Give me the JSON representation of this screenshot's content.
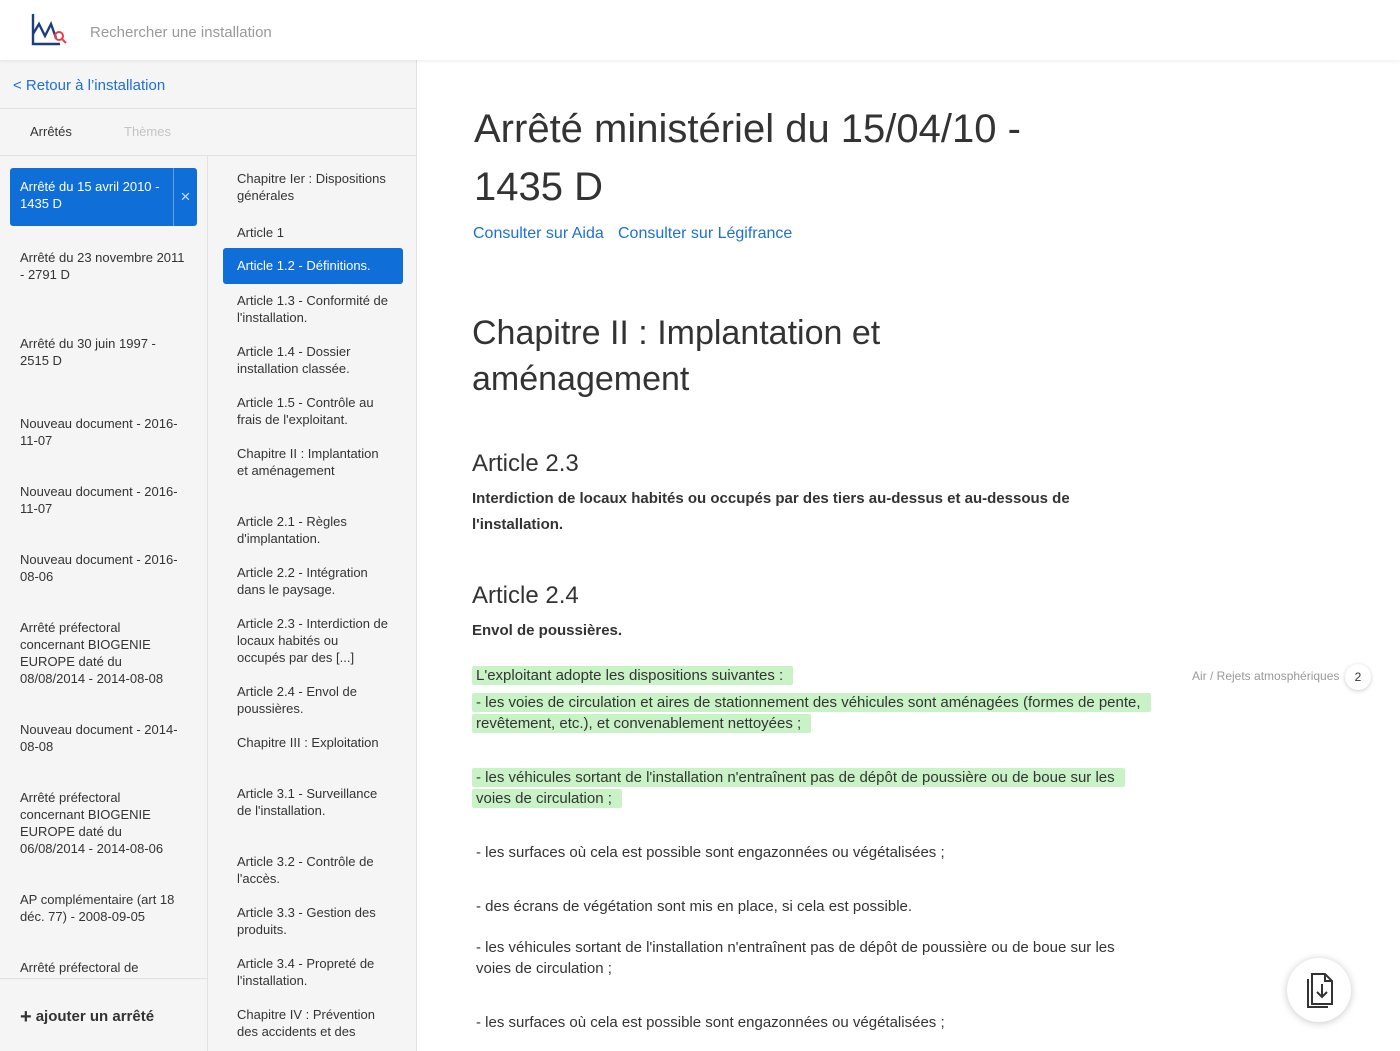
{
  "header": {
    "search_placeholder": "Rechercher une installation",
    "logo_icon": "chart-search-logo"
  },
  "sidebar": {
    "back_link": "< Retour à l’installation",
    "tabs": [
      {
        "label": "Arrêtés",
        "active": true
      },
      {
        "label": "Thèmes",
        "active": false
      }
    ],
    "arretes": [
      {
        "label": "Arrêté du 15 avril 2010 - 1435 D",
        "active": true
      },
      {
        "label": "Arrêté du 23 novembre 2011 - 2791 D"
      },
      {
        "label": "Arrêté du 30 juin 1997 - 2515 D"
      },
      {
        "label": "Nouveau document - 2016-11-07"
      },
      {
        "label": "Nouveau document - 2016-11-07"
      },
      {
        "label": "Nouveau document - 2016-08-06"
      },
      {
        "label": "Arrêté préfectoral concernant BIOGENIE EUROPE daté du 08/08/2014 - 2014-08-08"
      },
      {
        "label": "Nouveau document - 2014-08-08"
      },
      {
        "label": "Arrêté préfectoral concernant BIOGENIE EUROPE daté du 06/08/2014 - 2014-08-06"
      },
      {
        "label": "AP complémentaire (art 18 déc. 77) - 2008-09-05"
      },
      {
        "label": "Arrêté préfectoral de"
      }
    ],
    "close_icon": "×",
    "add_arrete": {
      "plus": "+",
      "label": "ajouter un arrêté"
    },
    "toc": [
      {
        "label": "Chapitre Ier : Dispositions générales"
      },
      {
        "label": "Article 1"
      },
      {
        "label": "Article 1.2 - Définitions.",
        "active": true
      },
      {
        "label": "Article 1.3 - Conformité de l'installation."
      },
      {
        "label": "Article 1.4 - Dossier installation classée."
      },
      {
        "label": "Article 1.5 - Contrôle au frais de l'exploitant."
      },
      {
        "label": "Chapitre II : Implantation et aménagement"
      },
      {
        "label": "Article 2.1 - Règles d'implantation."
      },
      {
        "label": "Article 2.2 - Intégration dans le paysage."
      },
      {
        "label": "Article 2.3 - Interdiction de locaux habités ou occupés par des [...]"
      },
      {
        "label": "Article 2.4 - Envol de poussières."
      },
      {
        "label": "Chapitre III : Exploitation"
      },
      {
        "label": "Article 3.1 - Surveillance de l'installation."
      },
      {
        "label": "Article 3.2 - Contrôle de l'accès."
      },
      {
        "label": "Article 3.3 - Gestion des produits."
      },
      {
        "label": "Article 3.4 - Propreté de l'installation."
      },
      {
        "label": "Chapitre IV : Prévention des accidents et des"
      }
    ]
  },
  "main": {
    "title": "Arrêté ministériel du 15/04/10 - 1435 D",
    "links": {
      "aida": "Consulter sur Aida",
      "legifrance": "Consulter sur Légifrance"
    },
    "chapter": "Chapitre II : Implantation et aménagement",
    "article_23": {
      "heading": "Article 2.3",
      "desc": "Interdiction de locaux habités ou occupés par des tiers au-dessus et au-dessous de l'installation."
    },
    "article_24": {
      "heading": "Article 2.4",
      "desc": "Envol de poussières.",
      "paragraphs": [
        {
          "text": "L'exploitant adopte les dispositions suivantes :",
          "highlight": true
        },
        {
          "text": "- les voies de circulation et aires de stationnement des véhicules sont aménagées (formes de pente, revêtement, etc.), et convenablement nettoyées ;",
          "highlight": true
        },
        {
          "text": "- les véhicules sortant de l'installation n'entraînent pas de dépôt de poussière ou de boue sur les voies de circulation ;",
          "highlight": true
        },
        {
          "text": "- les surfaces où cela est possible sont engazonnées ou végétalisées ;"
        },
        {
          "text": "- des écrans de végétation sont mis en place, si cela est possible."
        },
        {
          "text": "- les véhicules sortant de l'installation n'entraînent pas de dépôt de poussière ou de boue sur les voies de circulation ;"
        },
        {
          "text": "- les surfaces où cela est possible sont engazonnées ou végétalisées ;"
        }
      ]
    },
    "theme_tag": {
      "label": "Air / Rejets atmosphériques",
      "count": "2"
    },
    "highlight_color": "#c9f3c6",
    "accent_color": "#0f6ed8",
    "download_icon": "download-document-icon"
  }
}
